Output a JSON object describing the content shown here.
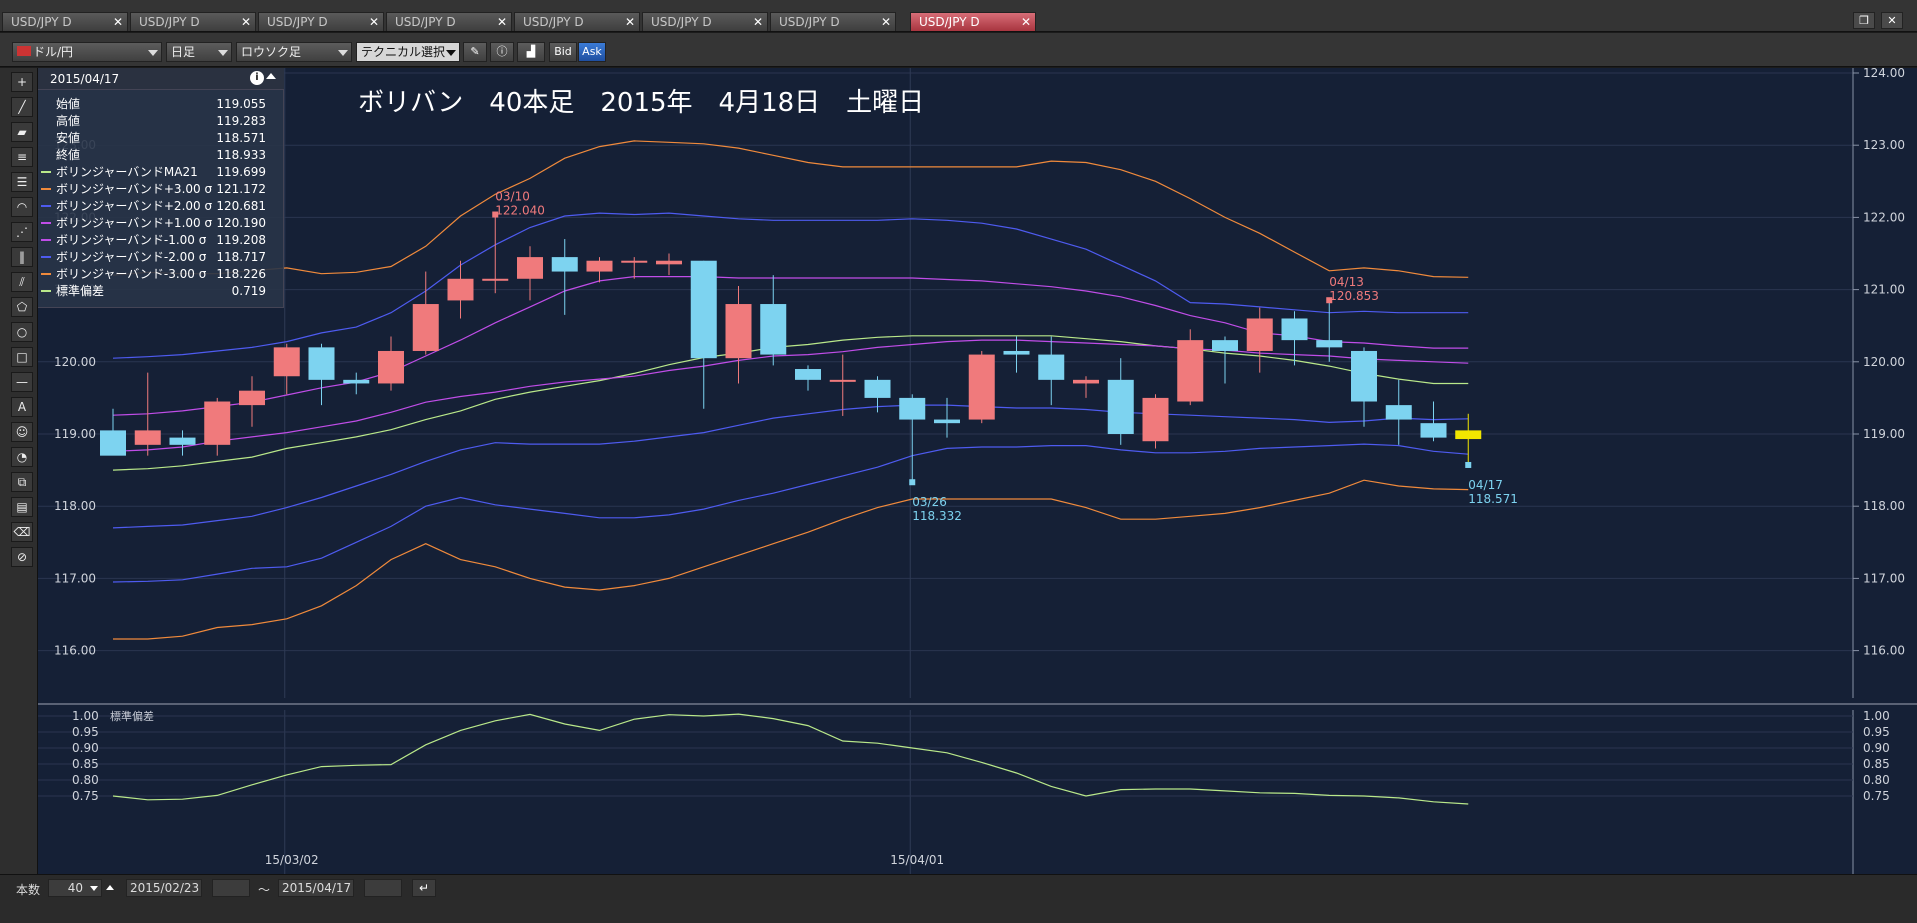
{
  "tabs": [
    {
      "label": "USD/JPY D",
      "active": false
    },
    {
      "label": "USD/JPY D",
      "active": false
    },
    {
      "label": "USD/JPY D",
      "active": false
    },
    {
      "label": "USD/JPY D",
      "active": false
    },
    {
      "label": "USD/JPY D",
      "active": false
    },
    {
      "label": "USD/JPY D",
      "active": false
    },
    {
      "label": "USD/JPY D",
      "active": false
    },
    {
      "label": "USD/JPY D",
      "active": true
    }
  ],
  "toolbar": {
    "pair": "ドル/円",
    "period": "日足",
    "chart_type": "ロウソク足",
    "technical": "テクニカル選択",
    "bid": "Bid",
    "ask": "Ask"
  },
  "overlay_title": "ボリバン　40本足　2015年　4月18日　土曜日",
  "info": {
    "date": "2015/04/17",
    "rows": [
      {
        "name": "始値",
        "value": "119.055",
        "color": ""
      },
      {
        "name": "高値",
        "value": "119.283",
        "color": ""
      },
      {
        "name": "安値",
        "value": "118.571",
        "color": ""
      },
      {
        "name": "終値",
        "value": "118.933",
        "color": ""
      },
      {
        "name": "ボリンジャーバンドMA21",
        "value": "119.699",
        "color": "#b9e88a"
      },
      {
        "name": "ボリンジャーバンド+3.00 σ",
        "value": "121.172",
        "color": "#f08a3c"
      },
      {
        "name": "ボリンジャーバンド+2.00 σ",
        "value": "120.681",
        "color": "#4e5bf0"
      },
      {
        "name": "ボリンジャーバンド+1.00 σ",
        "value": "120.190",
        "color": "#c04de8"
      },
      {
        "name": "ボリンジャーバンド-1.00 σ",
        "value": "119.208",
        "color": "#c04de8"
      },
      {
        "name": "ボリンジャーバンド-2.00 σ",
        "value": "118.717",
        "color": "#4e5bf0"
      },
      {
        "name": "ボリンジャーバンド-3.00 σ",
        "value": "118.226",
        "color": "#f08a3c"
      },
      {
        "name": "標準偏差",
        "value": "0.719",
        "color": "#b9e88a"
      }
    ]
  },
  "annotations": {
    "high1": {
      "date": "03/10",
      "price": "122.040"
    },
    "high2": {
      "date": "04/13",
      "price": "120.853"
    },
    "low1": {
      "date": "03/26",
      "price": "118.332"
    },
    "low2": {
      "date": "04/17",
      "price": "118.571"
    }
  },
  "sub_label": "標準偏差",
  "date_labels": [
    "15/03/02",
    "15/04/01"
  ],
  "bottom": {
    "count_label": "本数",
    "count": "40",
    "from": "2015/02/23",
    "to": "2015/04/17",
    "tilde": "～"
  },
  "colors": {
    "bull": "#f07a7c",
    "bear": "#7dd3f0",
    "ma": "#b9e88a",
    "sigma3": "#f08a3c",
    "sigma2": "#4e5bf0",
    "sigma1": "#c04de8",
    "last_candle": "#f2e600"
  },
  "chart_data": [
    {
      "type": "candlestick",
      "title": "ボリバン　40本足　2015年　4月18日　土曜日",
      "y_ticks": [
        "124.00",
        "123.00",
        "122.00",
        "121.00",
        "120.00",
        "119.00",
        "118.00",
        "117.00",
        "116.00"
      ],
      "ylim": [
        115.6,
        124.0
      ],
      "candles": [
        {
          "o": 119.05,
          "h": 119.35,
          "l": 118.75,
          "c": 118.7
        },
        {
          "o": 118.85,
          "h": 119.85,
          "l": 118.7,
          "c": 119.05
        },
        {
          "o": 118.95,
          "h": 119.05,
          "l": 118.7,
          "c": 118.85
        },
        {
          "o": 118.85,
          "h": 119.5,
          "l": 118.7,
          "c": 119.45
        },
        {
          "o": 119.4,
          "h": 119.8,
          "l": 119.1,
          "c": 119.6
        },
        {
          "o": 119.8,
          "h": 120.25,
          "l": 119.55,
          "c": 120.2
        },
        {
          "o": 120.2,
          "h": 120.25,
          "l": 119.4,
          "c": 119.75
        },
        {
          "o": 119.75,
          "h": 119.85,
          "l": 119.55,
          "c": 119.7
        },
        {
          "o": 119.7,
          "h": 120.35,
          "l": 119.6,
          "c": 120.15
        },
        {
          "o": 120.15,
          "h": 121.25,
          "l": 120.1,
          "c": 120.8
        },
        {
          "o": 120.85,
          "h": 121.4,
          "l": 120.6,
          "c": 121.15
        },
        {
          "o": 121.15,
          "h": 122.04,
          "l": 120.95,
          "c": 121.15
        },
        {
          "o": 121.15,
          "h": 121.6,
          "l": 120.85,
          "c": 121.45
        },
        {
          "o": 121.45,
          "h": 121.7,
          "l": 120.65,
          "c": 121.25
        },
        {
          "o": 121.25,
          "h": 121.45,
          "l": 121.1,
          "c": 121.4
        },
        {
          "o": 121.4,
          "h": 121.45,
          "l": 121.15,
          "c": 121.4
        },
        {
          "o": 121.35,
          "h": 121.5,
          "l": 121.2,
          "c": 121.4
        },
        {
          "o": 121.4,
          "h": 121.4,
          "l": 119.35,
          "c": 120.05
        },
        {
          "o": 120.05,
          "h": 121.05,
          "l": 119.7,
          "c": 120.8
        },
        {
          "o": 120.8,
          "h": 121.2,
          "l": 119.95,
          "c": 120.1
        },
        {
          "o": 119.9,
          "h": 119.95,
          "l": 119.6,
          "c": 119.75
        },
        {
          "o": 119.75,
          "h": 120.1,
          "l": 119.25,
          "c": 119.75
        },
        {
          "o": 119.75,
          "h": 119.8,
          "l": 119.3,
          "c": 119.5
        },
        {
          "o": 119.5,
          "h": 119.55,
          "l": 118.33,
          "c": 119.2
        },
        {
          "o": 119.2,
          "h": 119.5,
          "l": 118.95,
          "c": 119.15
        },
        {
          "o": 119.2,
          "h": 120.15,
          "l": 119.15,
          "c": 120.1
        },
        {
          "o": 120.15,
          "h": 120.35,
          "l": 119.85,
          "c": 120.1
        },
        {
          "o": 120.1,
          "h": 120.35,
          "l": 119.4,
          "c": 119.75
        },
        {
          "o": 119.7,
          "h": 119.8,
          "l": 119.5,
          "c": 119.75
        },
        {
          "o": 119.75,
          "h": 120.05,
          "l": 118.85,
          "c": 119.0
        },
        {
          "o": 118.9,
          "h": 119.55,
          "l": 118.8,
          "c": 119.5
        },
        {
          "o": 119.45,
          "h": 120.45,
          "l": 119.4,
          "c": 120.3
        },
        {
          "o": 120.3,
          "h": 120.35,
          "l": 119.7,
          "c": 120.15
        },
        {
          "o": 120.15,
          "h": 120.75,
          "l": 119.85,
          "c": 120.6
        },
        {
          "o": 120.6,
          "h": 120.7,
          "l": 119.95,
          "c": 120.3
        },
        {
          "o": 120.3,
          "h": 120.85,
          "l": 120.0,
          "c": 120.2
        },
        {
          "o": 120.15,
          "h": 120.2,
          "l": 119.1,
          "c": 119.45
        },
        {
          "o": 119.4,
          "h": 119.75,
          "l": 118.85,
          "c": 119.2
        },
        {
          "o": 119.15,
          "h": 119.45,
          "l": 118.9,
          "c": 118.95
        },
        {
          "o": 119.05,
          "h": 119.28,
          "l": 118.57,
          "c": 118.93
        }
      ],
      "bands": {
        "ma21": [
          118.5,
          118.52,
          118.56,
          118.62,
          118.68,
          118.8,
          118.88,
          118.96,
          119.06,
          119.2,
          119.32,
          119.48,
          119.58,
          119.66,
          119.74,
          119.84,
          119.96,
          120.06,
          120.12,
          120.2,
          120.24,
          120.3,
          120.34,
          120.36,
          120.36,
          120.36,
          120.36,
          120.36,
          120.32,
          120.28,
          120.22,
          120.18,
          120.12,
          120.08,
          120.02,
          119.94,
          119.84,
          119.76,
          119.7,
          119.7
        ],
        "p3": [
          121.2,
          121.24,
          121.22,
          121.22,
          121.26,
          121.3,
          121.22,
          121.24,
          121.32,
          121.6,
          122.02,
          122.32,
          122.54,
          122.82,
          122.98,
          123.06,
          123.04,
          123.02,
          122.96,
          122.86,
          122.76,
          122.7,
          122.7,
          122.7,
          122.7,
          122.7,
          122.7,
          122.78,
          122.76,
          122.66,
          122.5,
          122.26,
          122.0,
          121.78,
          121.52,
          121.26,
          121.3,
          121.26,
          121.18,
          121.17
        ],
        "p2": [
          120.05,
          120.07,
          120.1,
          120.15,
          120.2,
          120.28,
          120.4,
          120.48,
          120.68,
          120.98,
          121.34,
          121.62,
          121.86,
          122.02,
          122.06,
          122.04,
          122.06,
          122.02,
          121.98,
          121.96,
          121.96,
          121.96,
          121.96,
          121.98,
          121.96,
          121.92,
          121.84,
          121.7,
          121.56,
          121.34,
          121.12,
          120.82,
          120.8,
          120.76,
          120.72,
          120.68,
          120.7,
          120.68,
          120.68,
          120.68
        ],
        "p1": [
          119.26,
          119.28,
          119.32,
          119.38,
          119.44,
          119.54,
          119.64,
          119.72,
          119.86,
          120.08,
          120.3,
          120.54,
          120.76,
          120.98,
          121.12,
          121.18,
          121.18,
          121.18,
          121.16,
          121.16,
          121.16,
          121.16,
          121.16,
          121.16,
          121.14,
          121.12,
          121.08,
          121.04,
          120.98,
          120.9,
          120.78,
          120.64,
          120.54,
          120.4,
          120.36,
          120.28,
          120.26,
          120.22,
          120.19,
          120.19
        ],
        "m1": [
          118.76,
          118.78,
          118.82,
          118.9,
          118.96,
          119.02,
          119.1,
          119.18,
          119.3,
          119.44,
          119.52,
          119.58,
          119.66,
          119.72,
          119.76,
          119.8,
          119.88,
          119.94,
          120.02,
          120.08,
          120.1,
          120.14,
          120.2,
          120.24,
          120.28,
          120.3,
          120.3,
          120.28,
          120.26,
          120.24,
          120.22,
          120.18,
          120.16,
          120.12,
          120.1,
          120.08,
          120.04,
          120.02,
          120.0,
          119.98
        ],
        "m2": [
          117.7,
          117.72,
          117.74,
          117.8,
          117.86,
          117.98,
          118.12,
          118.28,
          118.44,
          118.62,
          118.78,
          118.88,
          118.86,
          118.86,
          118.86,
          118.9,
          118.96,
          119.02,
          119.12,
          119.22,
          119.28,
          119.34,
          119.38,
          119.4,
          119.4,
          119.38,
          119.36,
          119.36,
          119.34,
          119.3,
          119.28,
          119.26,
          119.24,
          119.22,
          119.2,
          119.16,
          119.18,
          119.22,
          119.2,
          119.21
        ],
        "m2b": [
          116.95,
          116.96,
          116.98,
          117.06,
          117.14,
          117.16,
          117.28,
          117.5,
          117.72,
          118.0,
          118.12,
          118.02,
          117.96,
          117.9,
          117.84,
          117.84,
          117.88,
          117.96,
          118.08,
          118.18,
          118.3,
          118.42,
          118.54,
          118.7,
          118.8,
          118.82,
          118.82,
          118.84,
          118.84,
          118.78,
          118.74,
          118.74,
          118.76,
          118.8,
          118.82,
          118.84,
          118.86,
          118.84,
          118.76,
          118.72
        ],
        "m3": [
          116.16,
          116.16,
          116.2,
          116.32,
          116.36,
          116.44,
          116.62,
          116.9,
          117.26,
          117.48,
          117.26,
          117.16,
          117.0,
          116.88,
          116.84,
          116.9,
          117.0,
          117.16,
          117.32,
          117.48,
          117.64,
          117.82,
          117.98,
          118.1,
          118.1,
          118.1,
          118.1,
          118.1,
          117.98,
          117.82,
          117.82,
          117.86,
          117.9,
          117.98,
          118.08,
          118.18,
          118.36,
          118.28,
          118.24,
          118.23
        ]
      }
    },
    {
      "type": "line",
      "title": "標準偏差",
      "y_ticks": [
        "1.00",
        "0.95",
        "0.90",
        "0.85",
        "0.80",
        "0.75"
      ],
      "ylim": [
        0.72,
        1.02
      ],
      "values": [
        0.75,
        0.738,
        0.74,
        0.752,
        0.785,
        0.816,
        0.842,
        0.846,
        0.848,
        0.91,
        0.955,
        0.985,
        1.005,
        0.975,
        0.955,
        0.99,
        1.004,
        1.0,
        1.006,
        0.992,
        0.97,
        0.922,
        0.915,
        0.9,
        0.885,
        0.855,
        0.822,
        0.78,
        0.75,
        0.77,
        0.772,
        0.772,
        0.766,
        0.76,
        0.758,
        0.752,
        0.75,
        0.744,
        0.732,
        0.725
      ]
    }
  ]
}
